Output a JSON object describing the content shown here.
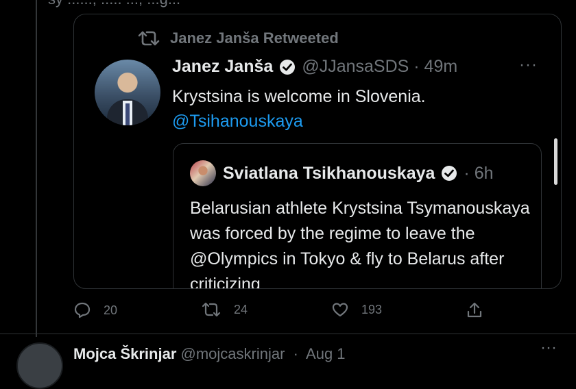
{
  "previous": {
    "cut_text": "sy  ......, .....  ...,  ...g..."
  },
  "retweet": {
    "label": "Janez Janša Retweeted"
  },
  "tweet": {
    "name": "Janez Janša",
    "handle": "@JJansaSDS",
    "time": "49m",
    "text": "Krystsina is welcome in Slovenia.",
    "mention": "@Tsihanouskaya",
    "more": "···"
  },
  "quote": {
    "name": "Sviatlana Tsikhanouskaya",
    "time": "6h",
    "text": "Belarusian athlete Krystsina Tsymanouskaya was forced by the regime to leave the @Olympics in Tokyo & fly to Belarus after criticizing"
  },
  "actions": {
    "replies": "20",
    "retweets": "24",
    "likes": "193"
  },
  "next_tweet": {
    "name": "Mojca Škrinjar",
    "handle": "@mojcaskrinjar",
    "time": "Aug 1",
    "more": "···"
  },
  "colors": {
    "background": "#000000",
    "text": "#e7e9ea",
    "muted": "#71767b",
    "link": "#1d9bf0",
    "border": "#2f3336"
  },
  "icons": [
    "retweet-icon",
    "verified-icon",
    "reply-icon",
    "like-icon",
    "share-icon",
    "more-icon"
  ]
}
